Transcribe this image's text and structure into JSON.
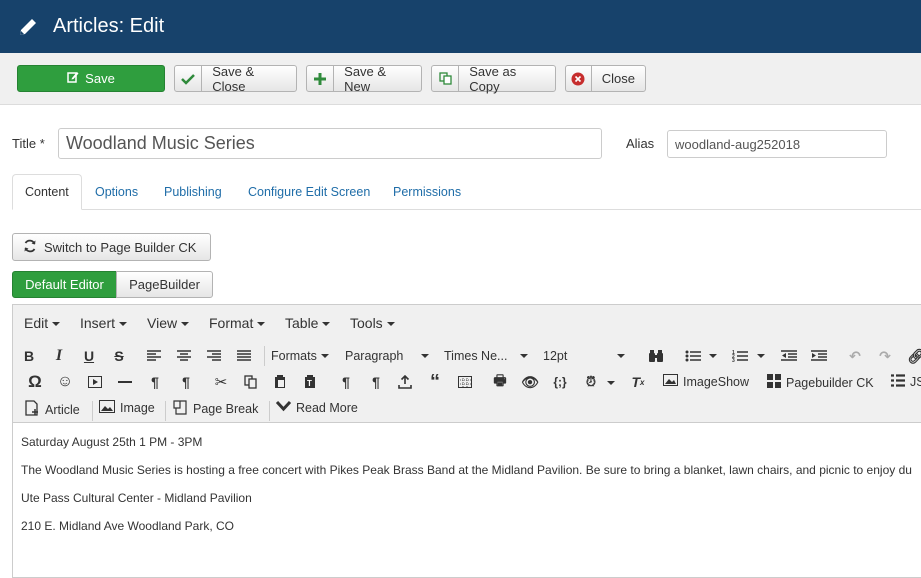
{
  "header": {
    "title": "Articles: Edit",
    "icon": "pencil-icon"
  },
  "toolbar": {
    "save": "Save",
    "save_close": "Save & Close",
    "save_new": "Save & New",
    "save_copy": "Save as Copy",
    "close": "Close"
  },
  "form": {
    "title_label": "Title *",
    "title_value": "Woodland Music Series",
    "alias_label": "Alias",
    "alias_value": "woodland-aug252018"
  },
  "tabs": [
    "Content",
    "Options",
    "Publishing",
    "Configure Edit Screen",
    "Permissions"
  ],
  "switch_builder": "Switch to Page Builder CK",
  "editor_switch": {
    "default": "Default Editor",
    "pagebuilder": "PageBuilder"
  },
  "editor": {
    "menus": [
      "Edit",
      "Insert",
      "View",
      "Format",
      "Table",
      "Tools"
    ],
    "formats": "Formats",
    "paragraph": "Paragraph",
    "font": "Times Ne...",
    "size": "12pt",
    "imageshow": "ImageShow",
    "pagebuilder_ck": "Pagebuilder CK",
    "js_cut": "JS",
    "article": "Article",
    "image": "Image",
    "page_break": "Page Break",
    "read_more": "Read More"
  },
  "content": {
    "p1": "Saturday August 25th 1 PM - 3PM",
    "p2": "The Woodland Music Series is hosting a free concert with Pikes Peak Brass Band at the Midland Pavilion. Be sure to bring a blanket, lawn chairs, and picnic to enjoy du",
    "p3": "Ute Pass Cultural Center - Midland Pavilion",
    "p4": "210 E. Midland Ave Woodland Park, CO"
  },
  "colors": {
    "header": "#17426b",
    "save": "#2f9e3e",
    "link": "#1f6da8"
  }
}
